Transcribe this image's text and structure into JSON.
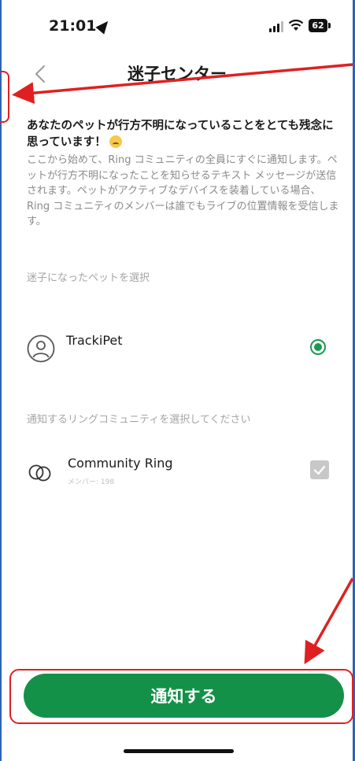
{
  "status_bar": {
    "time": "21:01",
    "battery": "62",
    "icons": [
      "location-arrow-icon",
      "signal-icon",
      "wifi-icon",
      "battery-icon"
    ]
  },
  "nav": {
    "title": "迷子センター",
    "back_icon": "chevron-left-icon"
  },
  "intro": {
    "heading": "あなたのペットが行方不明になっていることをとても残念に思っています！",
    "body": "ここから始めて、Ring コミュニティの全員にすぐに通知します。ペットが行方不明になったことを知らせるテキスト メッセージが送信されます。ペットがアクティブなデバイスを装着している場合、Ring コミュニティのメンバーは誰でもライブの位置情報を受信します。"
  },
  "pet_section": {
    "label": "迷子になったペットを選択",
    "pet": {
      "name": "TrackiPet",
      "selected": true,
      "icon": "pet-avatar-icon"
    }
  },
  "community_section": {
    "label": "通知するリングコミュニティを選択してください",
    "community": {
      "name": "Community Ring",
      "members": "メンバー: 198",
      "checked": true,
      "icon": "rings-icon"
    }
  },
  "notify_button": {
    "label": "通知する"
  },
  "colors": {
    "accent": "#149149",
    "radio": "#1a9a52",
    "annotation": "#e02020",
    "frame": "#2e63b8"
  }
}
